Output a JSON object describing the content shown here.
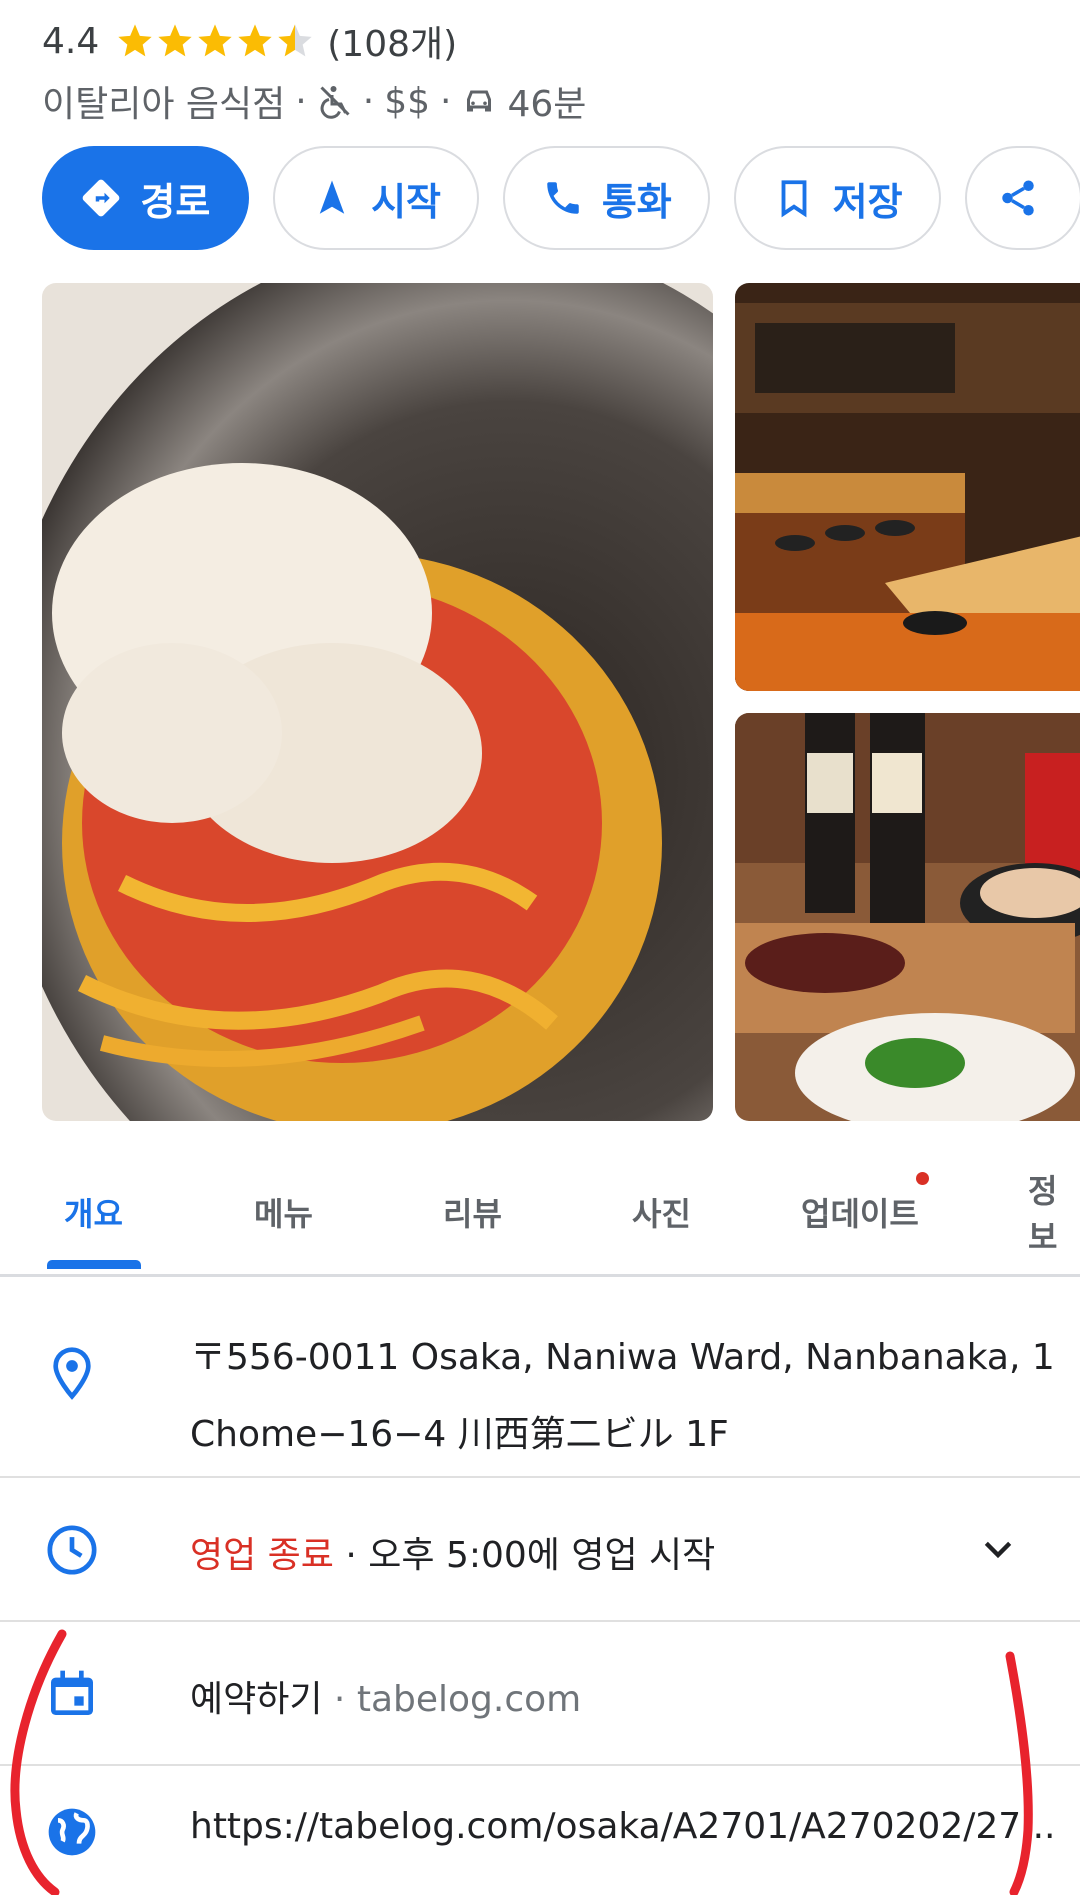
{
  "rating": {
    "value": "4.4",
    "count": "(108개)",
    "stars": 4.4
  },
  "meta": {
    "category": "이탈리아 음식점",
    "separator": "·",
    "price": "$$",
    "drive_time": "46분"
  },
  "actions": [
    {
      "label": "경로",
      "icon": "directions-icon"
    },
    {
      "label": "시작",
      "icon": "navigation-icon"
    },
    {
      "label": "통화",
      "icon": "phone-icon"
    },
    {
      "label": "저장",
      "icon": "bookmark-icon"
    },
    {
      "label": "",
      "icon": "share-icon"
    }
  ],
  "tabs": [
    "개요",
    "메뉴",
    "리뷰",
    "사진",
    "업데이트",
    "정보"
  ],
  "active_tab": "개요",
  "address": {
    "line1": "〒556-0011 Osaka, Naniwa Ward, Nanbanaka, 1",
    "line2": "Chome−16−4 川西第二ビル 1F"
  },
  "hours": {
    "status": "영업 종료",
    "separator": " · ",
    "detail": "오후 5:00에 영업 시작"
  },
  "reservation": {
    "label": "예약하기",
    "separator": " · ",
    "site": "tabelog.com"
  },
  "website": {
    "url": "https://tabelog.com/osaka/A2701/A270202/27..."
  },
  "colors": {
    "accent": "#1a73e8",
    "closed": "#d93025",
    "star": "#fbbc04",
    "annotation": "#e8232d"
  }
}
